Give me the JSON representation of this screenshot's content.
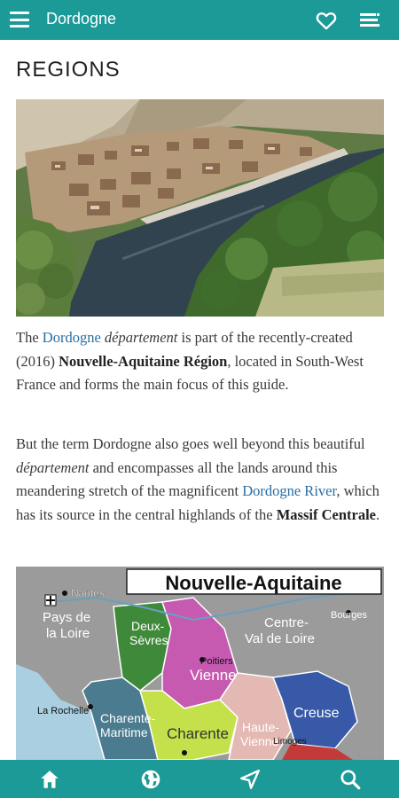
{
  "app": {
    "title": "Dordogne"
  },
  "page": {
    "heading": "REGIONS"
  },
  "p1": {
    "t1": "The ",
    "link1": "Dordogne",
    "t2": " ",
    "em1": "département",
    "t3": " is part of the recently-created (2016) ",
    "b1": "Nouvelle-Aquitaine Région",
    "t4": ", located in South-West France and forms the main focus of this guide."
  },
  "p2": {
    "t1": "But the term Dordogne also goes well beyond this beautiful ",
    "em1": "département",
    "t2": " and encompasses all the lands around this meandering stretch of the magnificent ",
    "link1": "Dordogne River",
    "t3": ", which has its source in the central highlands of the ",
    "b1": "Massif Centrale",
    "t4": "."
  },
  "map": {
    "title": "Nouvelle-Aquitaine",
    "labels": {
      "nantes": "Nantes",
      "pays": "Pays de",
      "loire": "la Loire",
      "centre1": "Centre-",
      "centre2": "Val de Loire",
      "bourges": "Bourges",
      "deux1": "Deux-",
      "deux2": "Sèvres",
      "poitiers": "Poitiers",
      "vienne": "Vienne",
      "rochelle": "La Rochelle",
      "charente1": "Charente-",
      "charente2": "Maritime",
      "charente": "Charente",
      "haute1": "Haute-",
      "haute2": "Vienne",
      "limoges": "Limoges",
      "creuse": "Creuse"
    }
  },
  "icons": {
    "menu": "menu-icon",
    "favorite": "heart-icon",
    "list": "list-icon",
    "home": "home-icon",
    "globe": "globe-icon",
    "navigate": "navigation-icon",
    "search": "search-icon"
  },
  "colors": {
    "bar": "#1c9a98",
    "link": "#2a6ea3"
  }
}
